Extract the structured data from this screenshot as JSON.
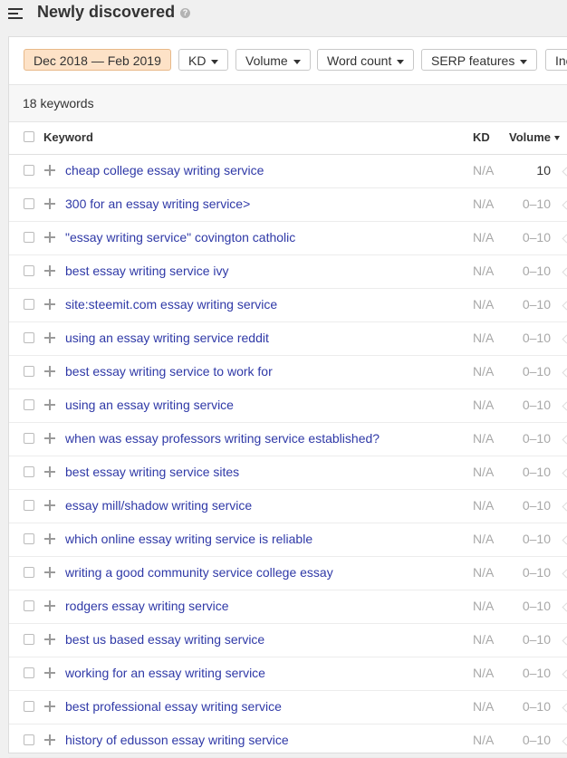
{
  "header": {
    "title": "Newly discovered",
    "help_glyph": "?"
  },
  "filters": {
    "date_range": "Dec 2018 — Feb 2019",
    "kd": "KD",
    "volume": "Volume",
    "word_count": "Word count",
    "serp_features": "SERP features",
    "more": "Inc"
  },
  "summary": {
    "count_text": "18 keywords"
  },
  "table": {
    "columns": {
      "keyword": "Keyword",
      "kd": "KD",
      "volume": "Volume"
    },
    "rows": [
      {
        "keyword": "cheap college essay writing service",
        "kd": "N/A",
        "volume": "10"
      },
      {
        "keyword": "300 for an essay writing service>",
        "kd": "N/A",
        "volume": "0–10"
      },
      {
        "keyword": "\"essay writing service\" covington catholic",
        "kd": "N/A",
        "volume": "0–10"
      },
      {
        "keyword": "best essay writing service ivy",
        "kd": "N/A",
        "volume": "0–10"
      },
      {
        "keyword": "site:steemit.com essay writing service",
        "kd": "N/A",
        "volume": "0–10"
      },
      {
        "keyword": "using an essay writing service reddit",
        "kd": "N/A",
        "volume": "0–10"
      },
      {
        "keyword": "best essay writing service to work for",
        "kd": "N/A",
        "volume": "0–10"
      },
      {
        "keyword": "using an essay writing service",
        "kd": "N/A",
        "volume": "0–10"
      },
      {
        "keyword": "when was essay professors writing service established?",
        "kd": "N/A",
        "volume": "0–10"
      },
      {
        "keyword": "best essay writing service sites",
        "kd": "N/A",
        "volume": "0–10"
      },
      {
        "keyword": "essay mill/shadow writing service",
        "kd": "N/A",
        "volume": "0–10"
      },
      {
        "keyword": "which online essay writing service is reliable",
        "kd": "N/A",
        "volume": "0–10"
      },
      {
        "keyword": "writing a good community service college essay",
        "kd": "N/A",
        "volume": "0–10"
      },
      {
        "keyword": "rodgers essay writing service",
        "kd": "N/A",
        "volume": "0–10"
      },
      {
        "keyword": "best us based essay writing service",
        "kd": "N/A",
        "volume": "0–10"
      },
      {
        "keyword": "working for an essay writing service",
        "kd": "N/A",
        "volume": "0–10"
      },
      {
        "keyword": "best professional essay writing service",
        "kd": "N/A",
        "volume": "0–10"
      },
      {
        "keyword": "history of edusson essay writing service",
        "kd": "N/A",
        "volume": "0–10"
      }
    ]
  },
  "colors": {
    "keyword_link": "#2f39a7",
    "date_filter_bg": "#fde2c7",
    "muted": "#a8a8a8"
  }
}
